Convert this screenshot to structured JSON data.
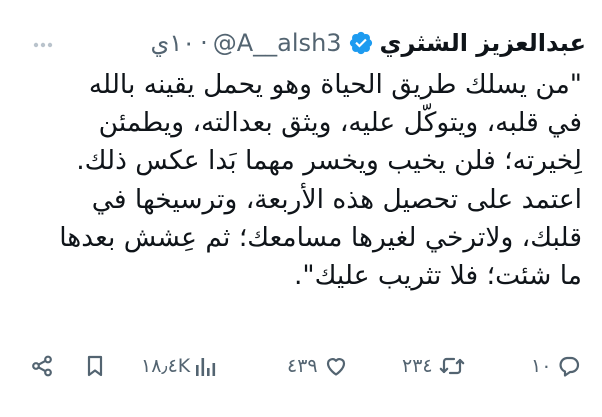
{
  "tweet": {
    "display_name": "عبدالعزيز الشثري",
    "verified_icon": "verified-badge-icon",
    "handle": "@A__alsh3",
    "separator": "·",
    "timestamp": "١٠ي",
    "body": "\"من يسلك طريق الحياة وهو يحمل يقينه بالله\nفي قلبه، ويتوكّل عليه، ويثق بعدالته، ويطمئن\nلِخيرته؛ فلن يخيب ويخسر مهما بَدا عكس ذلك.\nاعتمد على تحصيل هذه الأربعة، وترسيخها في\nقلبك، ولاترخي لغيرها مسامعك؛ ثم عِشش بعدها\nما شئت؛ فلا تثريب عليك\"."
  },
  "actions": {
    "replies": {
      "icon": "reply-icon",
      "count": "١٠"
    },
    "retweets": {
      "icon": "retweet-icon",
      "count": "٢٣٤"
    },
    "likes": {
      "icon": "heart-icon",
      "count": "٤٣٩"
    },
    "views": {
      "icon": "views-chart-icon",
      "count": "١٨٫٤K"
    },
    "bookmark": {
      "icon": "bookmark-icon"
    },
    "share": {
      "icon": "share-icon"
    }
  },
  "more_icon": "more-dots-icon",
  "colors": {
    "text": "#0f1419",
    "secondary": "#536471",
    "verified": "#1d9bf0",
    "background": "#ffffff"
  }
}
